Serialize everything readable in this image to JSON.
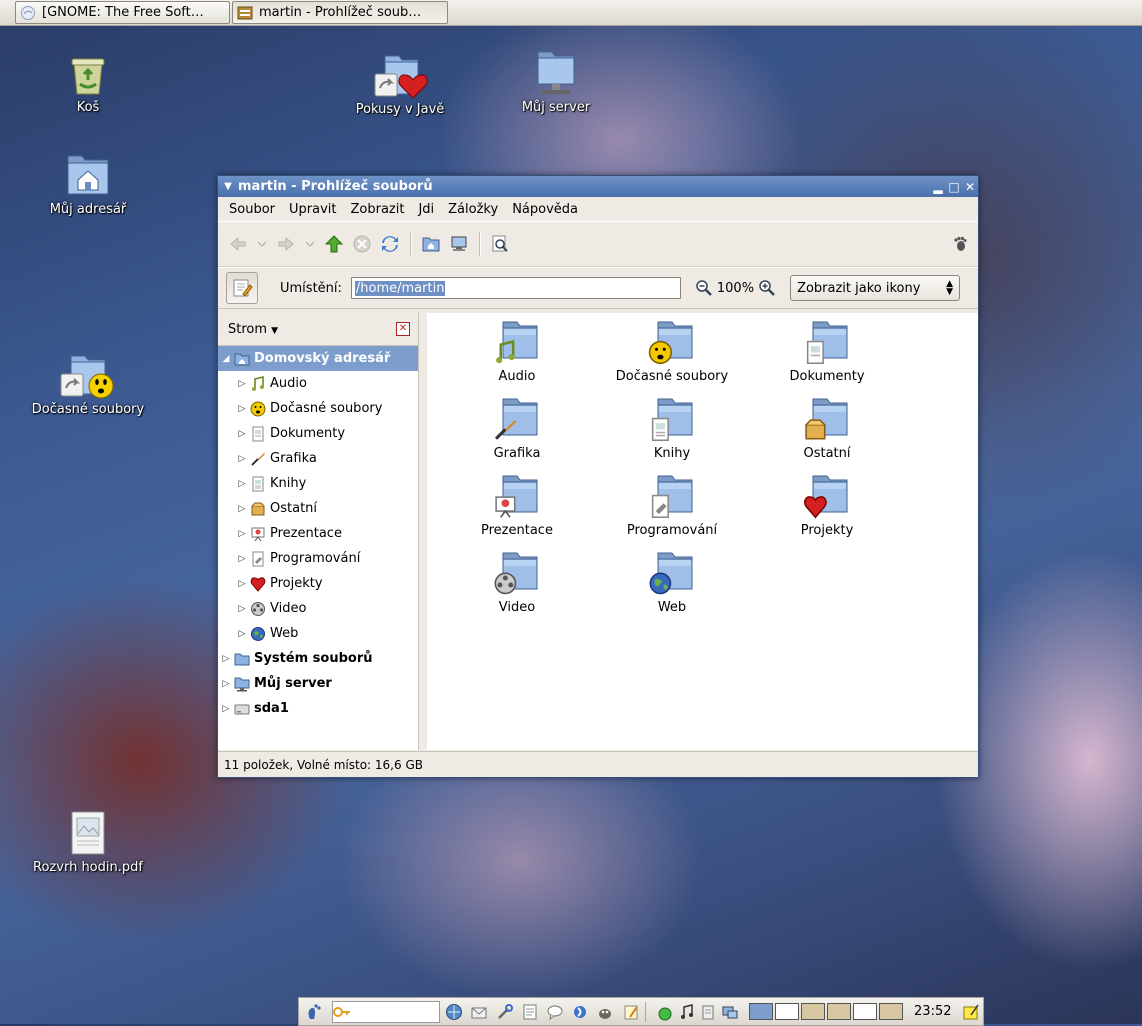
{
  "top_panel": {
    "tasks": [
      {
        "label": "[GNOME: The Free Soft…",
        "icon": "browser-icon",
        "active": false
      },
      {
        "label": "martin - Prohlížeč soub…",
        "icon": "file-manager-icon",
        "active": true
      }
    ]
  },
  "desktop": {
    "icons": [
      {
        "label": "Koš",
        "icon": "trash-icon"
      },
      {
        "label": "Pokusy v Javě",
        "icon": "folder-heart-icon"
      },
      {
        "label": "Můj server",
        "icon": "network-server-icon"
      },
      {
        "label": "Můj adresář",
        "icon": "home-folder-icon"
      },
      {
        "label": "Dočasné soubory",
        "icon": "temp-folder-icon"
      },
      {
        "label": "Rozvrh hodin.pdf",
        "icon": "pdf-file-icon"
      }
    ]
  },
  "window": {
    "title": "martin - Prohlížeč souborů",
    "menu": [
      "Soubor",
      "Upravit",
      "Zobrazit",
      "Jdi",
      "Záložky",
      "Nápověda"
    ],
    "location_label": "Umístění:",
    "location_value": "/home/martin",
    "zoom_level": "100%",
    "view_mode": "Zobrazit jako ikony",
    "sidebar": {
      "mode": "Strom",
      "tree": [
        {
          "label": "Domovský adresář",
          "icon": "home-folder-icon",
          "level": 0,
          "expanded": true,
          "selected": true
        },
        {
          "label": "Audio",
          "icon": "music-note-icon",
          "level": 1
        },
        {
          "label": "Dočasné soubory",
          "icon": "smiley-icon",
          "level": 1
        },
        {
          "label": "Dokumenty",
          "icon": "document-icon",
          "level": 1
        },
        {
          "label": "Grafika",
          "icon": "brush-icon",
          "level": 1
        },
        {
          "label": "Knihy",
          "icon": "book-icon",
          "level": 1
        },
        {
          "label": "Ostatní",
          "icon": "box-icon",
          "level": 1
        },
        {
          "label": "Prezentace",
          "icon": "presentation-icon",
          "level": 1
        },
        {
          "label": "Programování",
          "icon": "code-icon",
          "level": 1
        },
        {
          "label": "Projekty",
          "icon": "heart-icon",
          "level": 1
        },
        {
          "label": "Video",
          "icon": "film-reel-icon",
          "level": 1
        },
        {
          "label": "Web",
          "icon": "globe-icon",
          "level": 1
        },
        {
          "label": "Systém souborů",
          "icon": "folder-icon",
          "level": 0,
          "bold": true
        },
        {
          "label": "Můj server",
          "icon": "network-server-icon",
          "level": 0,
          "bold": true
        },
        {
          "label": "sda1",
          "icon": "drive-icon",
          "level": 0,
          "bold": true
        }
      ]
    },
    "files": [
      {
        "label": "Audio",
        "emblem": "music-note-icon"
      },
      {
        "label": "Dočasné soubory",
        "emblem": "smiley-icon"
      },
      {
        "label": "Dokumenty",
        "emblem": "document-icon"
      },
      {
        "label": "Grafika",
        "emblem": "brush-icon"
      },
      {
        "label": "Knihy",
        "emblem": "book-icon"
      },
      {
        "label": "Ostatní",
        "emblem": "box-icon"
      },
      {
        "label": "Prezentace",
        "emblem": "presentation-icon"
      },
      {
        "label": "Programování",
        "emblem": "code-icon"
      },
      {
        "label": "Projekty",
        "emblem": "heart-icon"
      },
      {
        "label": "Video",
        "emblem": "film-reel-icon"
      },
      {
        "label": "Web",
        "emblem": "globe-icon"
      }
    ],
    "status": "11 položek, Volné místo: 16,6 GB"
  },
  "bottom_panel": {
    "clock": "23:52"
  }
}
